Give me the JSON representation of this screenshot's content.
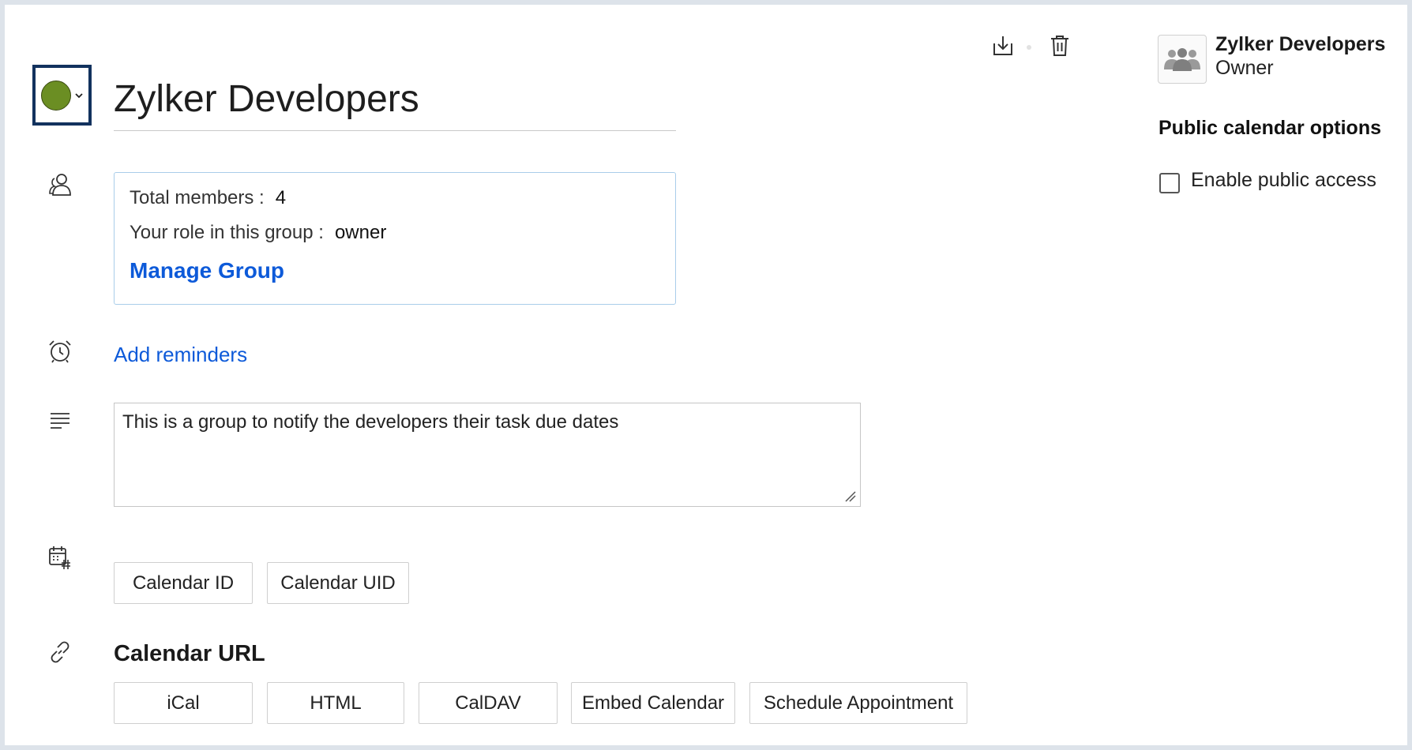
{
  "calendar": {
    "name": "Zylker Developers",
    "color": "#6b8e23"
  },
  "toolbar": {
    "export_icon": "download-icon",
    "delete_icon": "trash-icon"
  },
  "members": {
    "total_label": "Total members :",
    "total_value": "4",
    "role_label": "Your role in this group :",
    "role_value": "owner",
    "manage_link": "Manage Group"
  },
  "reminders": {
    "link": "Add reminders"
  },
  "description": {
    "value": "This is a group to notify the developers their task due dates"
  },
  "ids": {
    "calendar_id_button": "Calendar ID",
    "calendar_uid_button": "Calendar UID"
  },
  "urls": {
    "heading": "Calendar URL",
    "buttons": [
      "iCal",
      "HTML",
      "CalDAV",
      "Embed Calendar",
      "Schedule Appointment"
    ]
  },
  "owner": {
    "name": "Zylker Developers",
    "role": "Owner"
  },
  "public_options": {
    "heading": "Public calendar options",
    "enable_label": "Enable public access",
    "enabled": false
  }
}
